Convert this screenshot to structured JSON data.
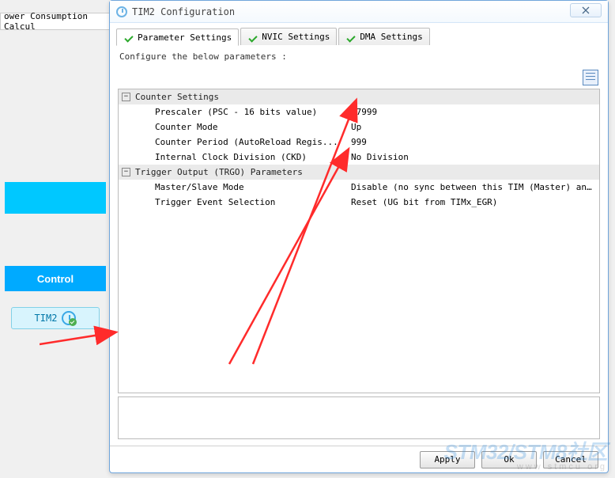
{
  "bg": {
    "tab_label": "ower Consumption Calcul",
    "control_label": "Control",
    "tim2_label": "TIM2"
  },
  "dialog": {
    "title": "TIM2 Configuration",
    "tabs": [
      {
        "label": "Parameter Settings"
      },
      {
        "label": "NVIC Settings"
      },
      {
        "label": "DMA Settings"
      }
    ],
    "instruction": "Configure the below parameters :",
    "groups": [
      {
        "name": "Counter Settings",
        "rows": [
          {
            "label": "Prescaler (PSC - 16 bits value)",
            "value": "47999"
          },
          {
            "label": "Counter Mode",
            "value": "Up"
          },
          {
            "label": "Counter Period (AutoReload Regis...",
            "value": "999"
          },
          {
            "label": "Internal Clock Division (CKD)",
            "value": "No Division"
          }
        ]
      },
      {
        "name": "Trigger Output (TRGO) Parameters",
        "rows": [
          {
            "label": "Master/Slave Mode",
            "value": "Disable (no sync between this TIM (Master) and ..."
          },
          {
            "label": "Trigger Event Selection",
            "value": "Reset (UG bit from TIMx_EGR)"
          }
        ]
      }
    ],
    "buttons": {
      "apply": "Apply",
      "ok": "Ok",
      "cancel": "Cancel"
    }
  },
  "watermark": {
    "main": "STM32/STM8社区",
    "sub": "www stmcu org"
  }
}
